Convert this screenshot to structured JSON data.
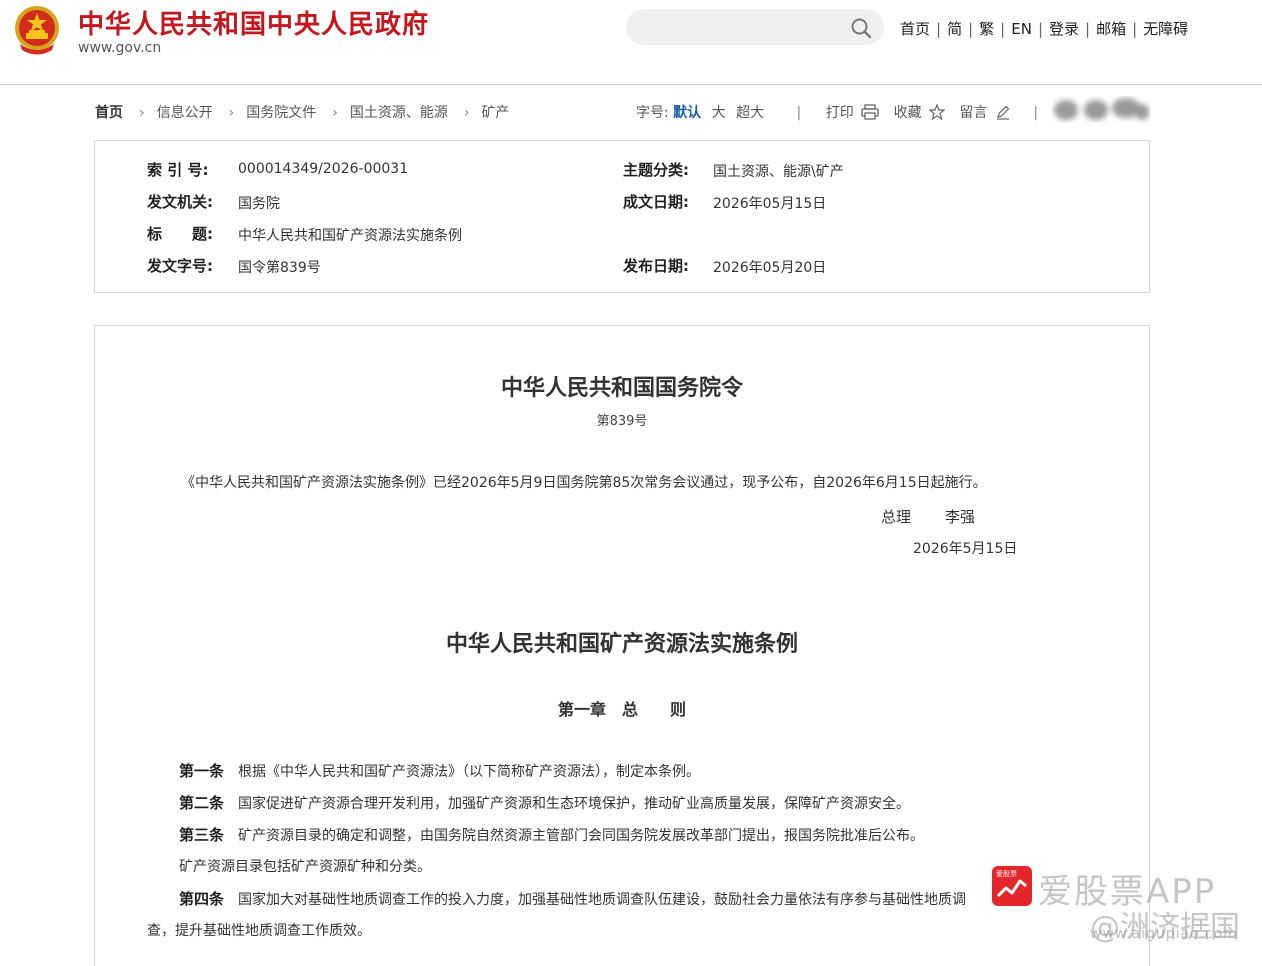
{
  "header": {
    "site_title": "中华人民共和国中央人民政府",
    "site_domain": "www.gov.cn",
    "nav": [
      "首页",
      "简",
      "繁",
      "EN",
      "登录",
      "邮箱",
      "无障碍"
    ]
  },
  "search": {
    "placeholder": ""
  },
  "breadcrumb": [
    "首页",
    "信息公开",
    "国务院文件",
    "国土资源、能源",
    "矿产"
  ],
  "toolbar": {
    "font_label": "字号:",
    "font_sizes": [
      "默认",
      "大",
      "超大"
    ],
    "print": "打印",
    "favorite": "收藏",
    "comment": "留言"
  },
  "meta": {
    "index_label": "索 引 号:",
    "index_value": "000014349/2026-00031",
    "category_label": "主题分类:",
    "category_value": "国土资源、能源\\矿产",
    "issuer_label": "发文机关:",
    "issuer_value": "国务院",
    "written_date_label": "成文日期:",
    "written_date_value": "2026年05月15日",
    "title_label": "标　　题:",
    "title_value": "中华人民共和国矿产资源法实施条例",
    "doc_no_label": "发文字号:",
    "doc_no_value": "国令第839号",
    "publish_date_label": "发布日期:",
    "publish_date_value": "2026年05月20日"
  },
  "article": {
    "order_title": "中华人民共和国国务院令",
    "order_number": "第839号",
    "promulgation": "《中华人民共和国矿产资源法实施条例》已经2026年5月9日国务院第85次常务会议通过，现予公布，自2026年6月15日起施行。",
    "signer_title": "总理",
    "signer_name": "李强",
    "sign_date": "2026年5月15日",
    "regulation_title": "中华人民共和国矿产资源法实施条例",
    "chapter_title": "第一章　总　　则",
    "paragraphs": [
      {
        "article": "第一条",
        "text": "根据《中华人民共和国矿产资源法》（以下简称矿产资源法），制定本条例。"
      },
      {
        "article": "第二条",
        "text": "国家促进矿产资源合理开发利用，加强矿产资源和生态环境保护，推动矿业高质量发展，保障矿产资源安全。"
      },
      {
        "article": "第三条",
        "text": "矿产资源目录的确定和调整，由国务院自然资源主管部门会同国务院发展改革部门提出，报国务院批准后公布。"
      },
      {
        "article": "",
        "text": "矿产资源目录包括矿产资源矿种和分类。"
      },
      {
        "article": "第四条",
        "text": "国家加大对基础性地质调查工作的投入力度，加强基础性地质调查队伍建设，鼓励社会力量依法有序参与基础性地质调"
      },
      {
        "article": "",
        "text": "查，提升基础性地质调查工作质效。"
      }
    ]
  },
  "watermark": {
    "app_logo_text": "爱股票",
    "app_text": "爱股票APP",
    "weibo": "@洲济据国",
    "url": "www.aigupiao.com"
  },
  "colors": {
    "brand_red": "#c4161c",
    "link_blue": "#1c5fa5"
  }
}
